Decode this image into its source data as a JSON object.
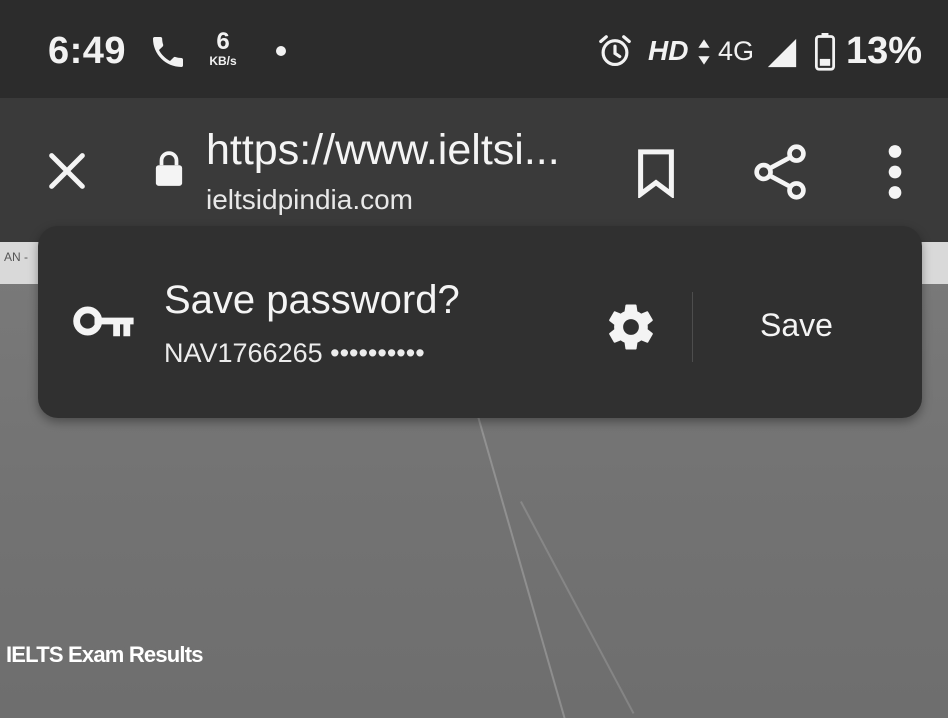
{
  "status_bar": {
    "time": "6:49",
    "net_speed_value": "6",
    "net_speed_unit": "KB/s",
    "hd_label": "HD",
    "network_label": "4G",
    "battery_percent": "13%",
    "icons": [
      "phone-call-icon",
      "alarm-clock-icon",
      "data-arrows-icon",
      "signal-icon",
      "battery-icon"
    ]
  },
  "toolbar": {
    "url_title": "https://www.ieltsi...",
    "domain": "ieltsidpindia.com",
    "icons": [
      "close-icon",
      "lock-icon",
      "bookmark-icon",
      "share-icon",
      "more-vert-icon"
    ]
  },
  "save_prompt": {
    "title": "Save password?",
    "username": "NAV1766265 ••••••••••",
    "save_label": "Save",
    "icons": [
      "key-icon",
      "gear-icon"
    ]
  },
  "page": {
    "strip_text": "AN -",
    "footer_text": "IELTS Exam Results"
  },
  "colors": {
    "status_bar_bg": "#2c2c2c",
    "toolbar_bg": "#3a3a3a",
    "prompt_bg": "#303030",
    "text": "#f4f4f4"
  }
}
